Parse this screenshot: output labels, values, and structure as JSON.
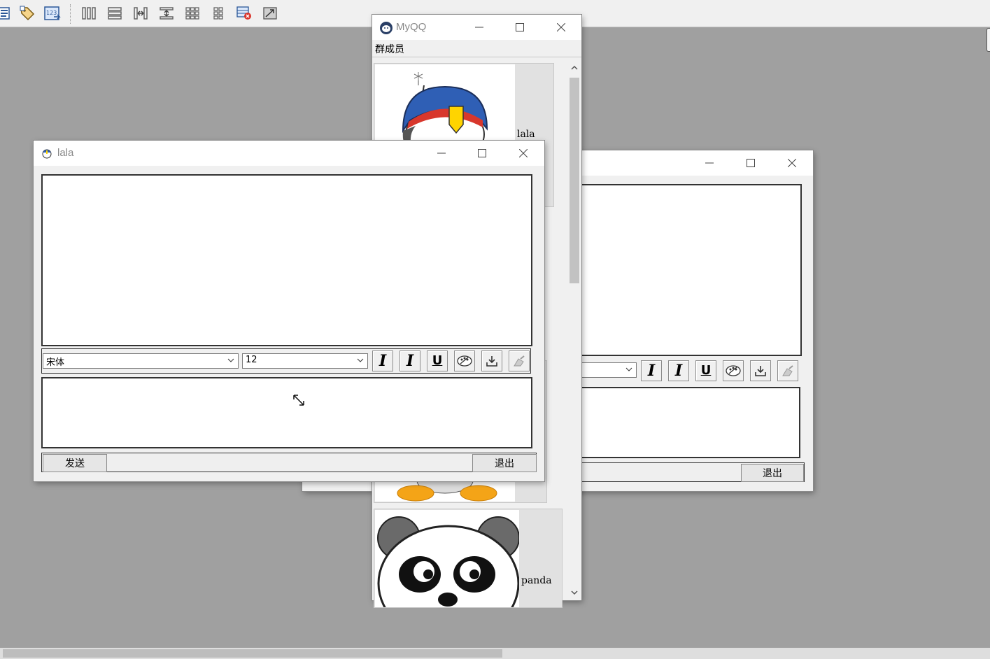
{
  "toolbar": {
    "icons": [
      "properties-icon",
      "tag-icon",
      "numbering-icon",
      "columns-icon",
      "rows-icon",
      "distribute-horizontal-icon",
      "distribute-vertical-icon",
      "grid-icon",
      "grid-small-icon",
      "table-settings-icon",
      "image-icon"
    ]
  },
  "myqq": {
    "title": "MyQQ",
    "menu": "群成员",
    "members": [
      {
        "name": "lala",
        "avatar": "qing-emperor-avatar"
      },
      {
        "name": "panda",
        "avatar": "panda-avatar"
      }
    ]
  },
  "chat_lala": {
    "title": "lala",
    "font_select": "宋体",
    "size_select": "12",
    "send_label": "发送",
    "exit_label": "退出"
  },
  "chat_back": {
    "exit_label": "退出"
  },
  "colors": {
    "desktop": "#a0a0a0",
    "window_bg": "#f0f0f0",
    "titlebar": "#ffffff",
    "title_text": "#888888"
  }
}
